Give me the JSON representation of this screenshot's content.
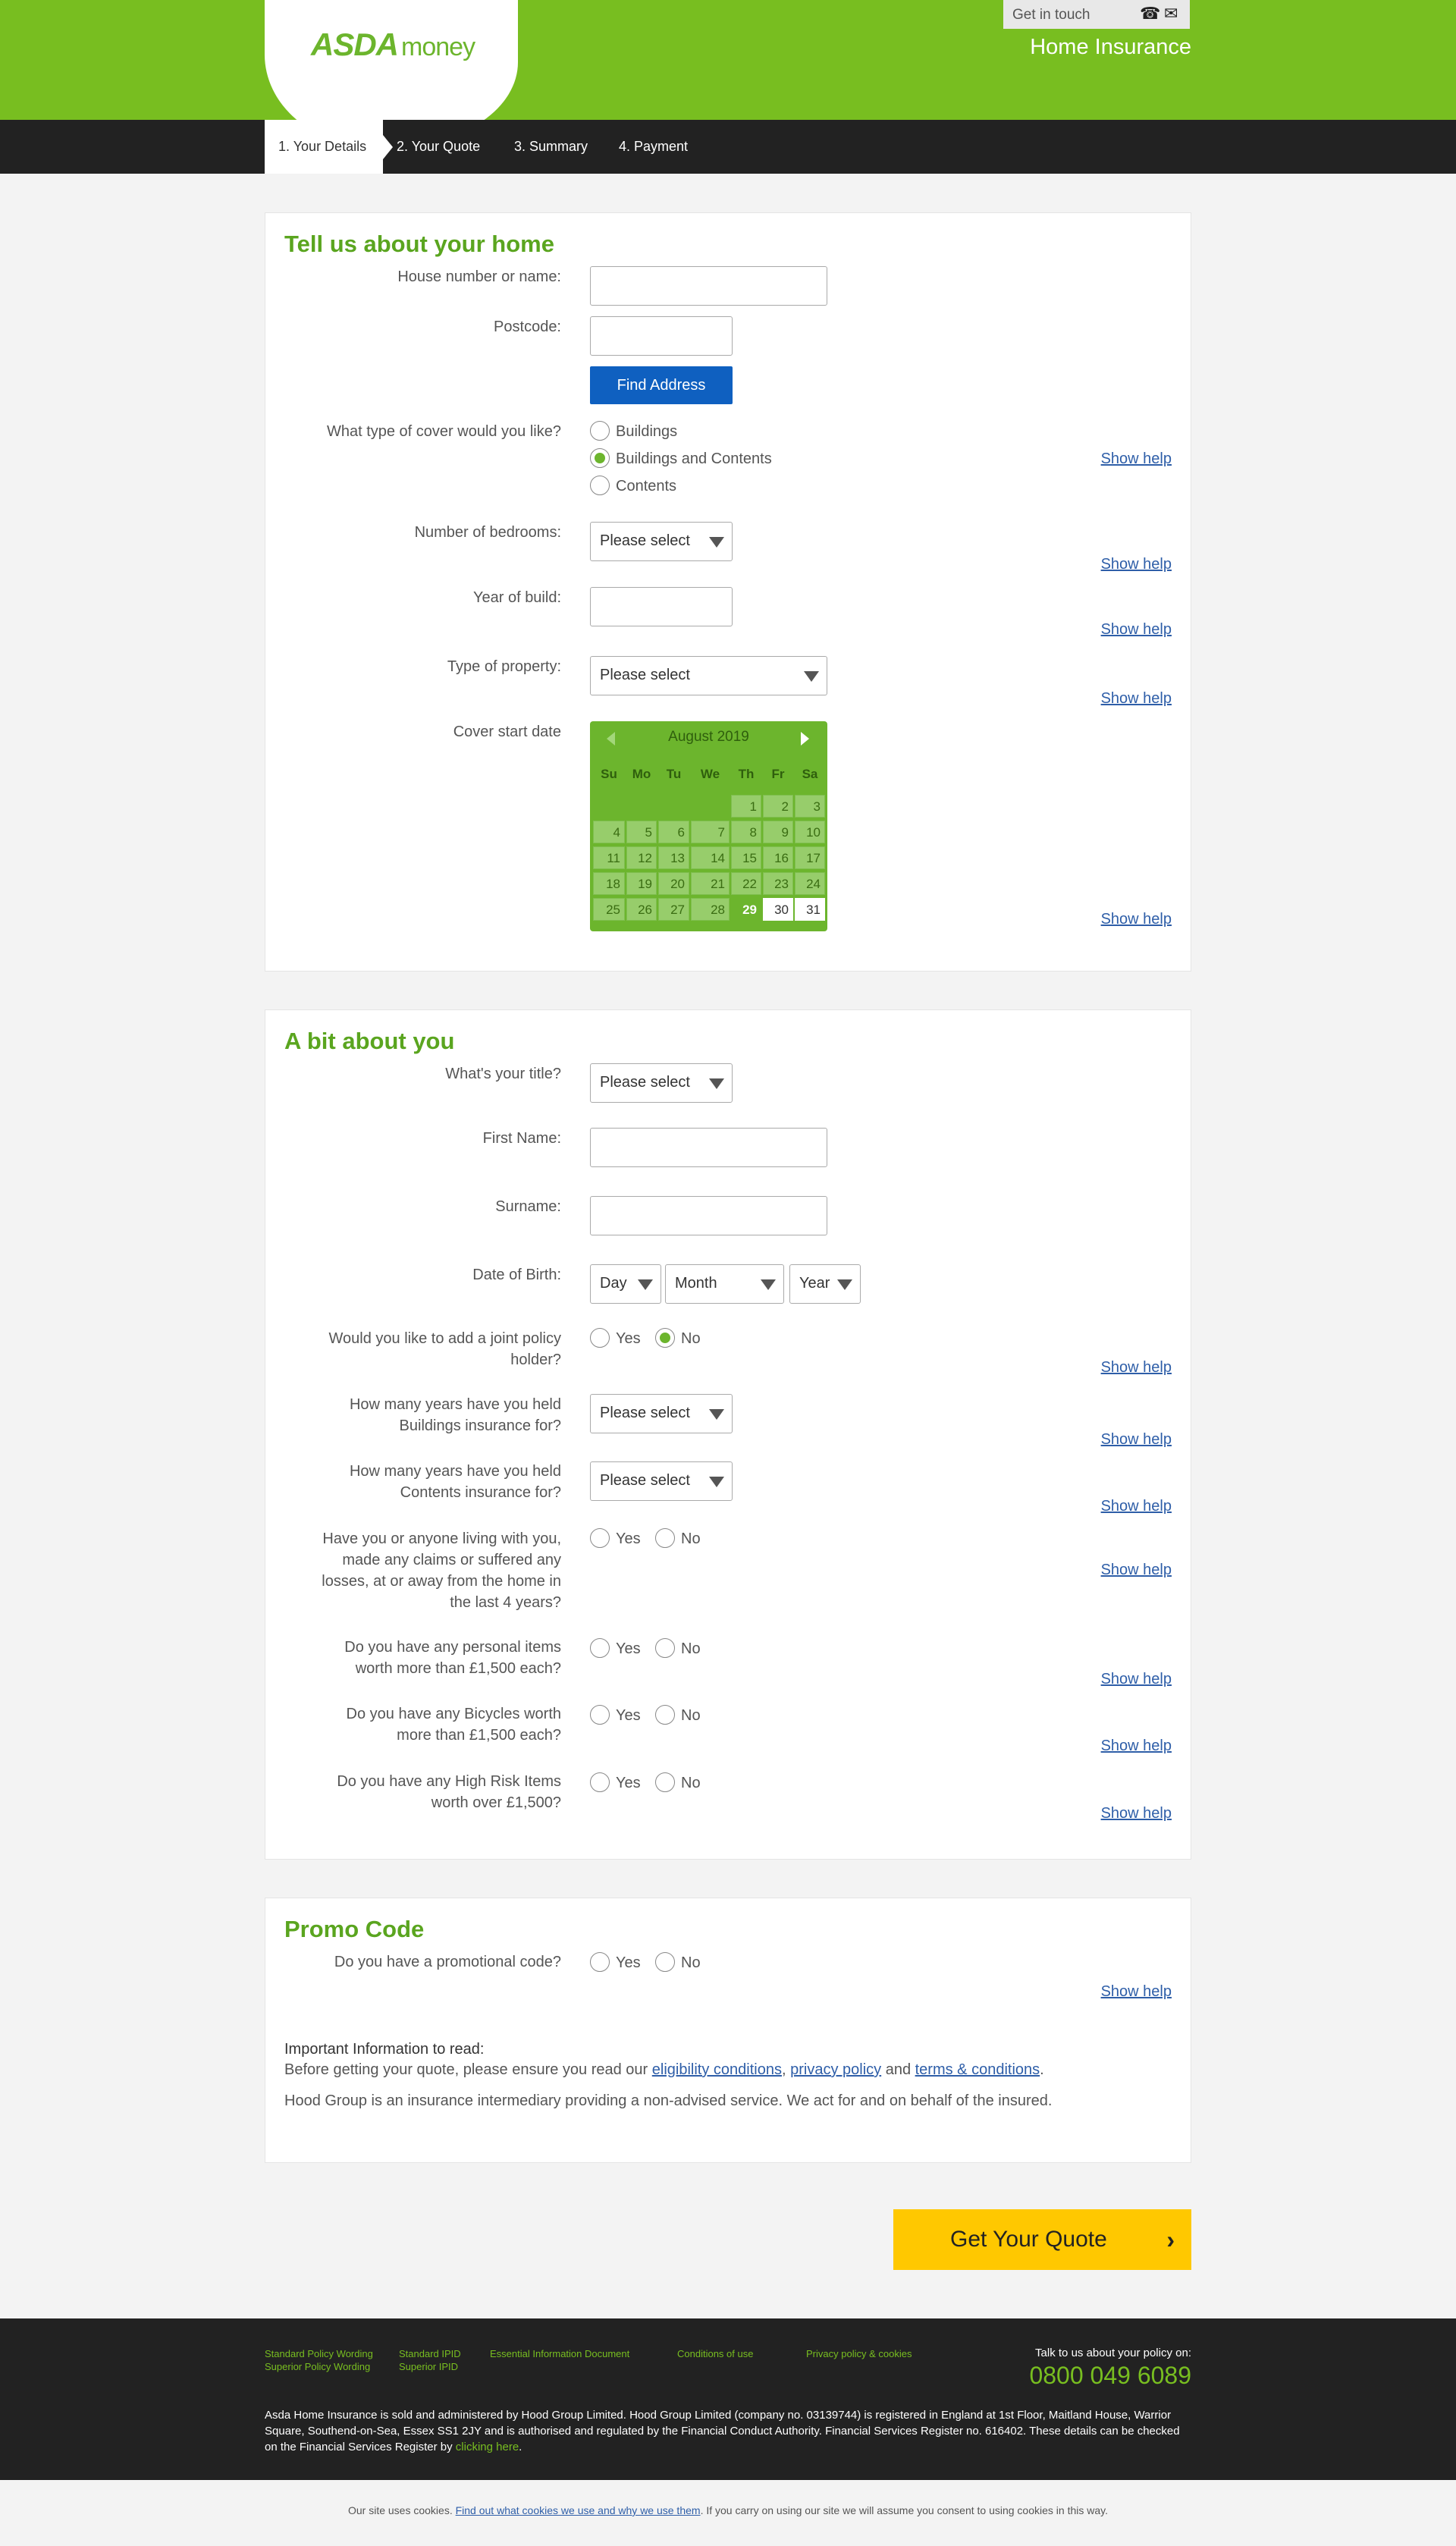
{
  "brand": {
    "logo_bold": "ASDA",
    "logo_light": "money"
  },
  "header": {
    "get_in_touch": "Get in touch",
    "phone_icon": "☎",
    "mail_icon": "✉",
    "product": "Home Insurance"
  },
  "steps": [
    "1. Your Details",
    "2. Your Quote",
    "3. Summary",
    "4. Payment"
  ],
  "home": {
    "title": "Tell us about your home",
    "house_label": "House number or name:",
    "postcode_label": "Postcode:",
    "find_address": "Find Address",
    "cover_label": "What type of cover would you like?",
    "cover_options": [
      "Buildings",
      "Buildings and Contents",
      "Contents"
    ],
    "cover_selected": "Buildings and Contents",
    "bedrooms_label": "Number of bedrooms:",
    "bedrooms_value": "Please select",
    "year_label": "Year of build:",
    "property_label": "Type of property:",
    "property_value": "Please select",
    "start_label": "Cover start date",
    "help": "Show help"
  },
  "calendar": {
    "month": "August 2019",
    "days_of_week": [
      "Su",
      "Mo",
      "Tu",
      "We",
      "Th",
      "Fr",
      "Sa"
    ],
    "dates": [
      "1",
      "2",
      "3",
      "4",
      "5",
      "6",
      "7",
      "8",
      "9",
      "10",
      "11",
      "12",
      "13",
      "14",
      "15",
      "16",
      "17",
      "18",
      "19",
      "20",
      "21",
      "22",
      "23",
      "24",
      "25",
      "26",
      "27",
      "28",
      "29",
      "30",
      "31"
    ],
    "selected": "29",
    "available": [
      "29",
      "30",
      "31"
    ]
  },
  "about": {
    "title": "A bit about you",
    "title_label": "What's your title?",
    "title_value": "Please select",
    "first_label": "First Name:",
    "surname_label": "Surname:",
    "dob_label": "Date of Birth:",
    "dob_day": "Day",
    "dob_month": "Month",
    "dob_year": "Year",
    "joint_label_1": "Would you like to add a joint policy",
    "joint_label_2": "holder?",
    "yes": "Yes",
    "no": "No",
    "buildings_years_1": "How many years have you held",
    "buildings_years_2": "Buildings insurance for?",
    "contents_years_1": "How many years have you held",
    "contents_years_2": "Contents insurance for?",
    "select_value": "Please select",
    "claims_1": "Have you or anyone living with you,",
    "claims_2": "made any claims or suffered any",
    "claims_3": "losses, at or away from the home in",
    "claims_4": "the last 4 years?",
    "personal_1": "Do you have any personal items",
    "personal_2": "worth more than £1,500 each?",
    "bikes_1": "Do you have any Bicycles worth",
    "bikes_2": "more than £1,500 each?",
    "risk_1": "Do you have any High Risk Items",
    "risk_2": "worth over £1,500?"
  },
  "promo": {
    "title": "Promo Code",
    "label": "Do you have a promotional code?",
    "info_heading": "Important Information to read:",
    "info_p1a": "Before getting your quote, please ensure you read our ",
    "link_eligibility": "eligibility conditions",
    "sep1": ", ",
    "link_privacy": "privacy policy",
    "sep2": " and ",
    "link_terms": "terms & conditions",
    "sep3": ".",
    "info_p2": "Hood Group is an insurance intermediary providing a non-advised service. We act for and on behalf of the insured."
  },
  "cta": {
    "label": "Get Your Quote",
    "icon": "›"
  },
  "footer": {
    "links": [
      "Standard Policy Wording",
      "Superior Policy Wording",
      "Standard IPID",
      "Superior IPID",
      "Essential Information Document",
      "Conditions of use",
      "Privacy policy & cookies"
    ],
    "talk": "Talk to us about your policy on:",
    "phone": "0800 049 6089",
    "disclaimer": "Asda Home Insurance is sold and administered by Hood Group Limited. Hood Group Limited (company no. 03139744) is registered in England at 1st Floor, Maitland House, Warrior Square, Southend-on-Sea, Essex SS1 2JY and is authorised and regulated by the Financial Conduct Authority. Financial Services Register no. 616402. These details can be checked on the Financial Services Register by ",
    "disclaimer_link": "clicking here",
    "disclaimer_end": "."
  },
  "cookie": {
    "pre": "Our site uses cookies. ",
    "link": "Find out what cookies we use and why we use them",
    "post": ". If you carry on using our site we will assume you consent to using cookies in this way."
  }
}
